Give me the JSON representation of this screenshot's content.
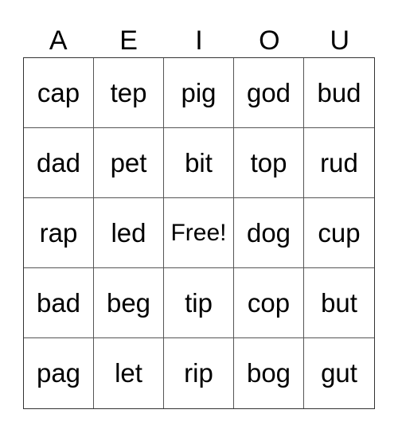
{
  "header": [
    "A",
    "E",
    "I",
    "O",
    "U"
  ],
  "rows": [
    [
      "cap",
      "tep",
      "pig",
      "god",
      "bud"
    ],
    [
      "dad",
      "pet",
      "bit",
      "top",
      "rud"
    ],
    [
      "rap",
      "led",
      "Free!",
      "dog",
      "cup"
    ],
    [
      "bad",
      "beg",
      "tip",
      "cop",
      "but"
    ],
    [
      "pag",
      "let",
      "rip",
      "bog",
      "gut"
    ]
  ]
}
